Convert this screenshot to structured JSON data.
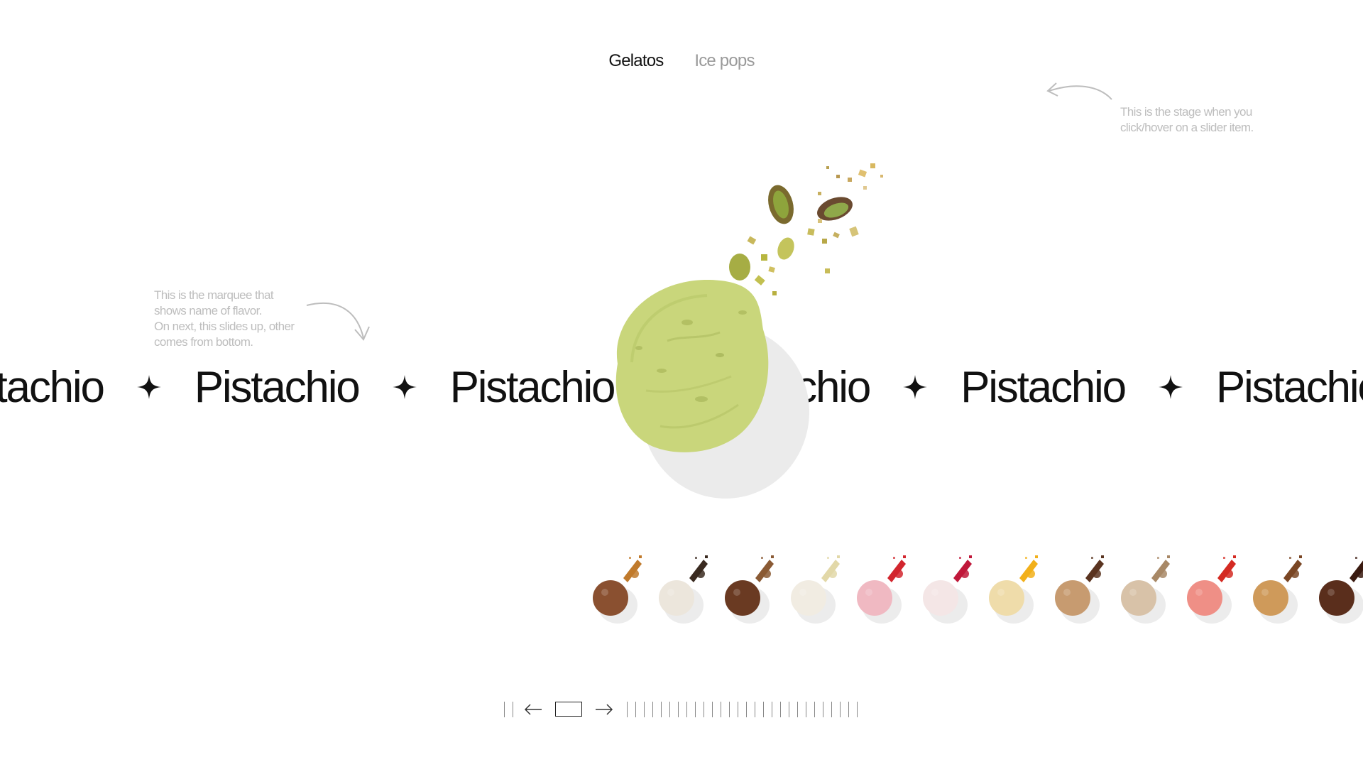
{
  "tabs": [
    {
      "label": "Gelatos",
      "active": true
    },
    {
      "label": "Ice pops",
      "active": false
    }
  ],
  "annotations": {
    "stage": [
      "This is the stage when you",
      "click/hover on a slider item."
    ],
    "marquee": [
      "This is the marquee that",
      "shows name of flavor.",
      "On next, this slides up, other",
      "comes from bottom."
    ]
  },
  "marquee": {
    "flavor": "Pistachio",
    "separator_icon": "four-point-star-icon"
  },
  "hero": {
    "flavor": "Pistachio",
    "scoop_color": "#c9d67b",
    "shadow_color": "#ebebeb"
  },
  "slider": {
    "items": [
      {
        "scoop": "#8a5030",
        "topping": "#c07a2c",
        "kind": "caramel"
      },
      {
        "scoop": "#ece6dc",
        "topping": "#3a2a20",
        "kind": "cookies"
      },
      {
        "scoop": "#6a3a22",
        "topping": "#8a5a34",
        "kind": "hazelnut"
      },
      {
        "scoop": "#f1ece2",
        "topping": "#e2d8a8",
        "kind": "vanilla"
      },
      {
        "scoop": "#f0b9c2",
        "topping": "#d2262e",
        "kind": "strawberry"
      },
      {
        "scoop": "#f4e6e6",
        "topping": "#c0183a",
        "kind": "berry"
      },
      {
        "scoop": "#efdcaa",
        "topping": "#f2b01a",
        "kind": "passionfruit"
      },
      {
        "scoop": "#c79b70",
        "topping": "#5a3420",
        "kind": "chocolate-chip"
      },
      {
        "scoop": "#d8c2a8",
        "topping": "#a88866",
        "kind": "cookie-dough"
      },
      {
        "scoop": "#ef8f86",
        "topping": "#d42a22",
        "kind": "raspberry"
      },
      {
        "scoop": "#cf9a5a",
        "topping": "#7a4624",
        "kind": "cookie"
      },
      {
        "scoop": "#5a2e1c",
        "topping": "#3a1a10",
        "kind": "dark-chocolate"
      }
    ]
  },
  "pager": {
    "prev_icon": "arrow-left-icon",
    "next_icon": "arrow-right-icon",
    "ticks_before": 2,
    "ticks_after": 28
  }
}
